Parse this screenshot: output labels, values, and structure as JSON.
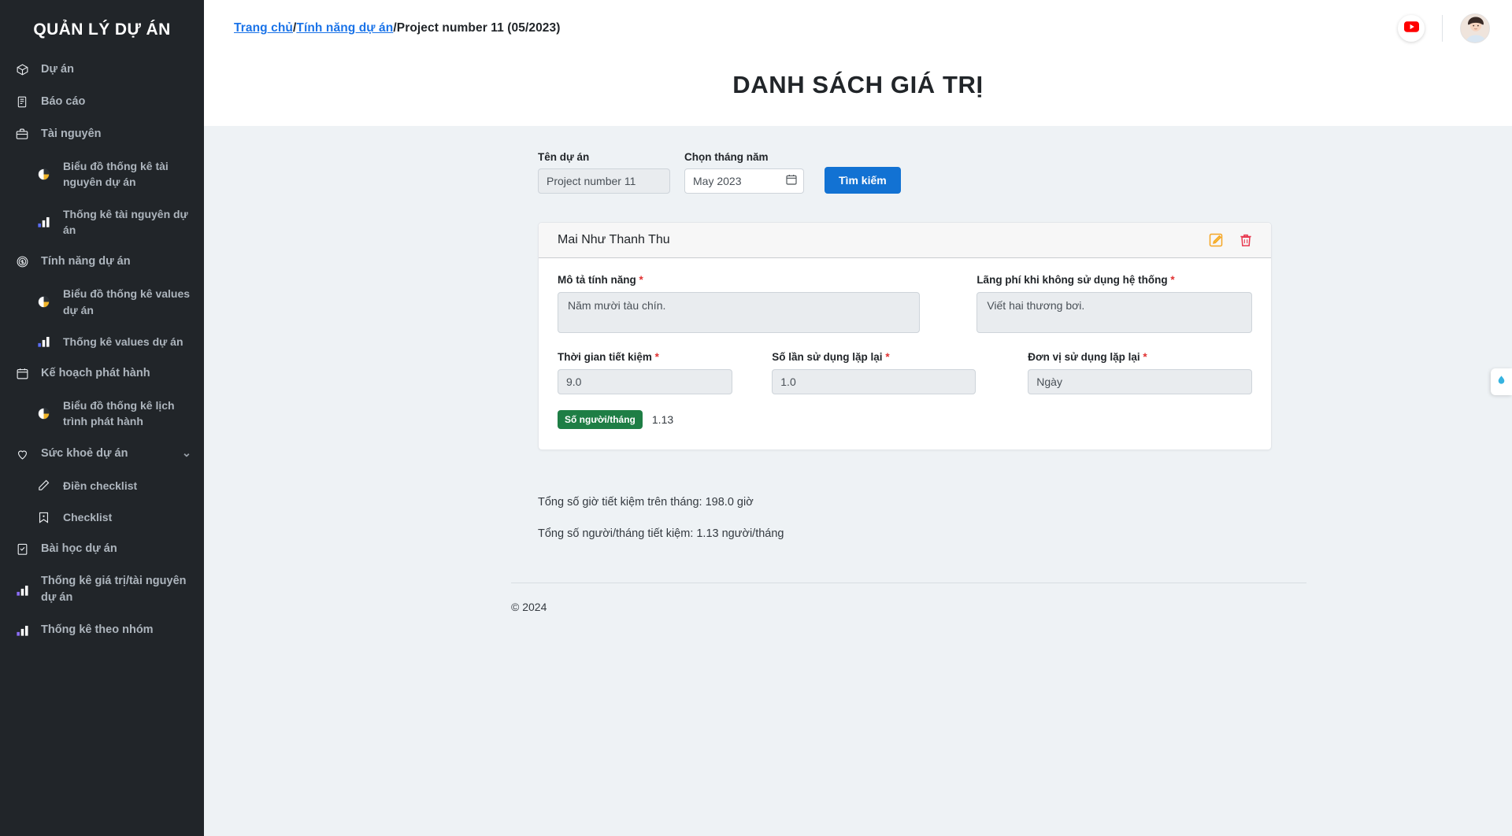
{
  "sidebar": {
    "brand": "QUẢN LÝ DỰ ÁN",
    "items": [
      {
        "label": "Dự án",
        "icon": "box-icon",
        "sub": false
      },
      {
        "label": "Báo cáo",
        "icon": "report-icon",
        "sub": false
      },
      {
        "label": "Tài nguyên",
        "icon": "briefcase-icon",
        "sub": false
      },
      {
        "label": "Biểu đồ thống kê tài nguyên dự án",
        "icon": "pie-chart-icon",
        "sub": true
      },
      {
        "label": "Thống kê tài nguyên dự án",
        "icon": "bar-chart-icon",
        "sub": true
      },
      {
        "label": "Tính năng dự án",
        "icon": "coin-icon",
        "sub": false
      },
      {
        "label": "Biểu đồ thống kê values dự án",
        "icon": "pie-chart-icon",
        "sub": true
      },
      {
        "label": "Thống kê values dự án",
        "icon": "bar-chart-icon",
        "sub": true
      },
      {
        "label": "Kế hoạch phát hành",
        "icon": "calendar-icon",
        "sub": false
      },
      {
        "label": "Biểu đồ thống kê lịch trình phát hành",
        "icon": "pie-chart-icon",
        "sub": true
      },
      {
        "label": "Sức khoẻ dự án",
        "icon": "heart-icon",
        "sub": false,
        "chevron": "⌄"
      },
      {
        "label": "Điền checklist",
        "icon": "pencil-icon",
        "sub": true
      },
      {
        "label": "Checklist",
        "icon": "bookmark-icon",
        "sub": true
      },
      {
        "label": "Bài học dự án",
        "icon": "clipboard-check-icon",
        "sub": false
      },
      {
        "label": "Thống kê giá trị/tài nguyên dự án",
        "icon": "bar-chart-icon",
        "sub": false
      },
      {
        "label": "Thống kê theo nhóm",
        "icon": "bar-chart-icon",
        "sub": false
      }
    ]
  },
  "header": {
    "breadcrumb": {
      "home": "Trang chủ",
      "sep1": "/",
      "section": "Tính năng dự án",
      "sep2": "/",
      "current": "Project number 11 (05/2023)"
    },
    "youtube_icon": "youtube-icon"
  },
  "page": {
    "title": "DANH SÁCH GIÁ TRỊ"
  },
  "filters": {
    "project_label": "Tên dự án",
    "project_value": "Project number 11",
    "month_label": "Chọn tháng năm",
    "month_value": "May 2023",
    "search_button": "Tìm kiếm"
  },
  "card": {
    "owner": "Mai Như Thanh Thu",
    "edit_icon": "edit-icon",
    "delete_icon": "trash-icon",
    "fields": {
      "feature_desc_label": "Mô tả tính năng",
      "feature_desc_value": "Năm mười tàu chín.",
      "waste_label": "Lãng phí khi không sử dụng hệ thống",
      "waste_value": "Viết hai thương bơi.",
      "time_saved_label": "Thời gian tiết kiệm",
      "time_saved_value": "9.0",
      "repeat_count_label": "Số lần sử dụng lặp lại",
      "repeat_count_value": "1.0",
      "repeat_unit_label": "Đơn vị sử dụng lặp lại",
      "repeat_unit_value": "Ngày",
      "required_mark": "*"
    },
    "badge_label": "Số người/tháng",
    "badge_value": "1.13"
  },
  "totals": {
    "hours": "Tổng số giờ tiết kiệm trên tháng: 198.0 giờ",
    "people": "Tổng số người/tháng tiết kiệm: 1.13 người/tháng"
  },
  "footer": {
    "copyright": "© 2024"
  },
  "colors": {
    "sidebar_bg": "#212529",
    "link": "#1a73e8",
    "primary_button": "#1272d3",
    "badge_green": "#1e7e45",
    "required_red": "#e03131",
    "edit_orange": "#f5a623",
    "delete_red": "#e8384f"
  }
}
